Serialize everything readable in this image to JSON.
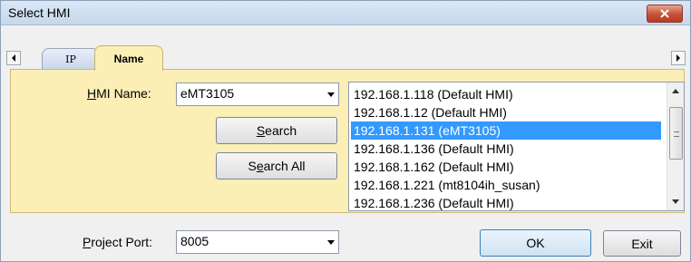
{
  "window": {
    "title": "Select HMI"
  },
  "tabs": [
    {
      "label": "IP",
      "active": false
    },
    {
      "label": "Name",
      "active": true
    }
  ],
  "hmi_name": {
    "label_prefix": "H",
    "label_rest": "MI Name:",
    "value": "eMT3105"
  },
  "buttons": {
    "search_ak": "S",
    "search_rest": "earch",
    "search_all_pre": "S",
    "search_all_ak": "e",
    "search_all_rest": "arch All",
    "ok": "OK",
    "exit": "Exit"
  },
  "hmi_list": {
    "items": [
      "192.168.1.118 (Default HMI)",
      "192.168.1.12 (Default HMI)",
      "192.168.1.131 (eMT3105)",
      "192.168.1.136 (Default HMI)",
      "192.168.1.162 (Default HMI)",
      "192.168.1.221 (mt8104ih_susan)",
      "192.168.1.236 (Default HMI)"
    ],
    "selected_index": 2
  },
  "project_port": {
    "label_prefix": "P",
    "label_rest": "roject Port:",
    "value": "8005"
  },
  "colors": {
    "panel_bg": "#fbefb6",
    "selection": "#3399ff",
    "close_button": "#c75036"
  },
  "icons": {
    "close": "close-x-icon",
    "tab_left": "chevron-left-icon",
    "tab_right": "chevron-right-icon",
    "dropdown": "chevron-down-icon",
    "scroll_up": "scroll-up-icon",
    "scroll_down": "scroll-down-icon"
  }
}
